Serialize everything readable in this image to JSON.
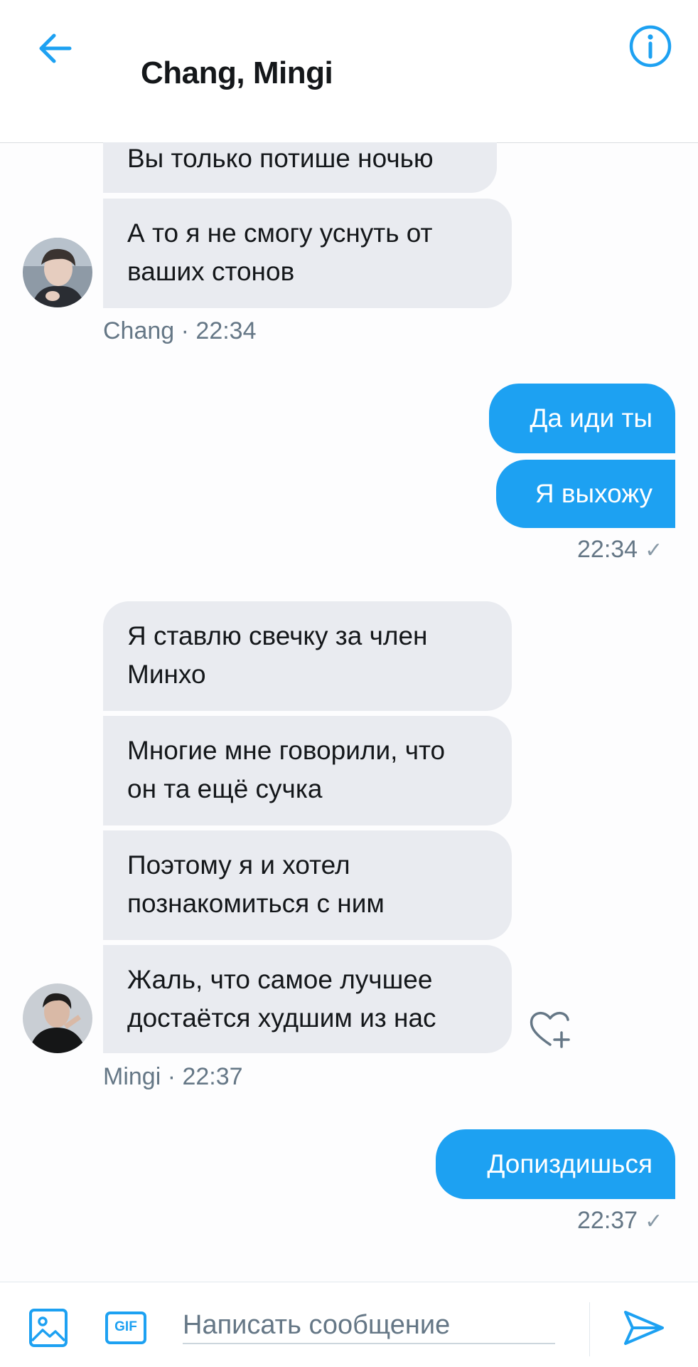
{
  "header": {
    "title": "Chang, Mingi",
    "back_icon": "arrow-left-icon",
    "info_icon": "info-icon",
    "accent_color": "#1da1f2"
  },
  "messages": {
    "group1": {
      "bubbles": [
        "Вы только потише ночью",
        "А то я не смогу уснуть от",
        "ваших стонов"
      ],
      "meta": "Chang · 22:34"
    },
    "group2": {
      "bubbles": [
        "Да иди ты",
        "Я выхожу"
      ],
      "meta": "22:34",
      "check": "✓"
    },
    "group3": {
      "bubbles": [
        "Я ставлю свечку за член",
        "Минхо",
        "Многие мне говорили, что",
        "он та ещё сучка",
        "Поэтому я и хотел",
        "познакомиться с ним",
        "Жаль, что самое лучшее",
        "достаётся худшим из нас"
      ],
      "meta": "Mingi · 22:37"
    },
    "group4": {
      "bubbles": [
        "Допиздишься"
      ],
      "meta": "22:37",
      "check": "✓"
    }
  },
  "composer": {
    "placeholder": "Написать сообщение",
    "gif_label": "GIF",
    "image_icon": "image-icon",
    "send_icon": "send-icon"
  },
  "colors": {
    "incoming_bubble": "#e9ebf0",
    "outgoing_bubble": "#1da1f2",
    "meta_text": "#657786"
  }
}
